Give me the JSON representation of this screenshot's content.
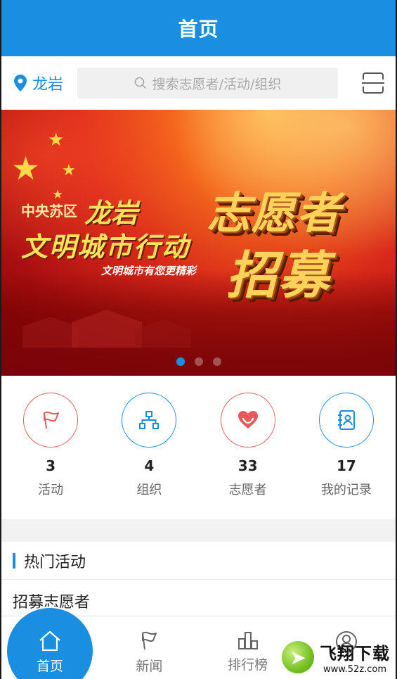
{
  "header": {
    "title": "首页"
  },
  "location": {
    "city": "龙岩"
  },
  "search": {
    "placeholder": "搜索志愿者/活动/组织"
  },
  "banner": {
    "subtitle": "中央苏区",
    "city": "龙岩",
    "main": "文明城市行动",
    "slogan": "文明城市有您更精彩",
    "big_line1": "志愿者",
    "big_line2": "招募",
    "dots_total": 3,
    "dots_active_index": 0
  },
  "stats": [
    {
      "num": "3",
      "label": "活动",
      "icon": "flag-icon"
    },
    {
      "num": "4",
      "label": "组织",
      "icon": "org-chart-icon"
    },
    {
      "num": "33",
      "label": "志愿者",
      "icon": "heart-icon"
    },
    {
      "num": "17",
      "label": "我的记录",
      "icon": "record-icon"
    }
  ],
  "hot": {
    "title": "热门活动",
    "items": [
      {
        "title": "招募志愿者"
      }
    ]
  },
  "tabbar": {
    "home": "首页",
    "news": "新闻",
    "rank": "排行榜"
  },
  "watermark": {
    "title": "飞翔下载",
    "url": "www.52z.com"
  },
  "colors": {
    "primary": "#1a8ee1",
    "accent_red": "#ea5a5a"
  }
}
